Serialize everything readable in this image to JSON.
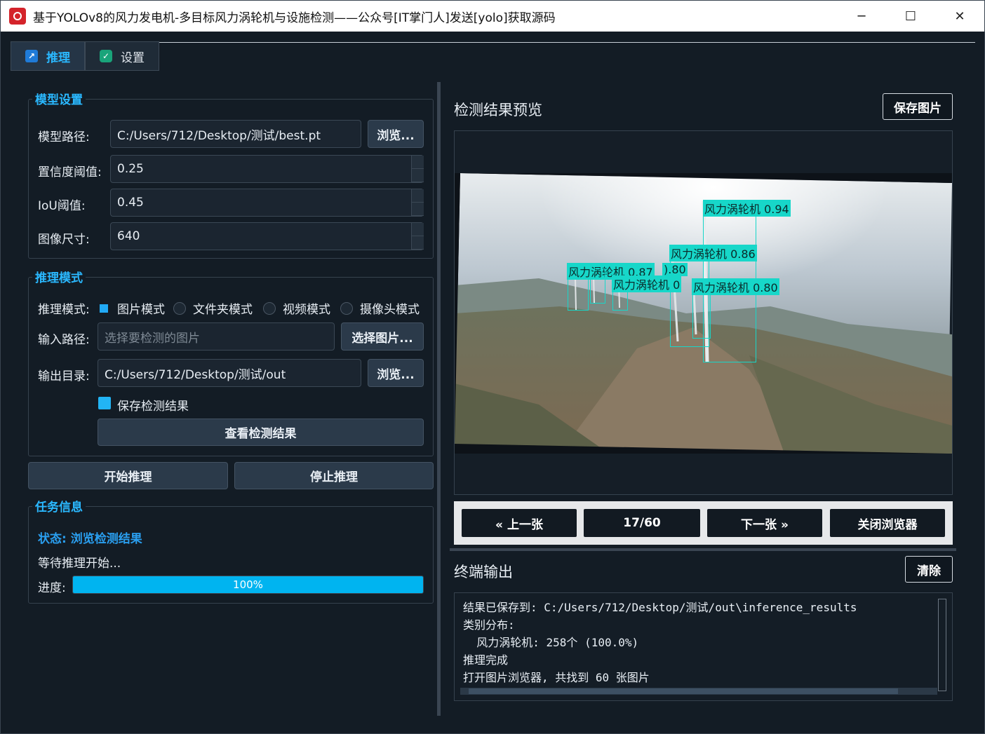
{
  "window": {
    "title": "基于YOLOv8的风力发电机-多目标风力涡轮机与设施检测——公众号[IT掌门人]发送[yolo]获取源码",
    "minimize": "─",
    "maximize": "☐",
    "close": "✕"
  },
  "tabs": [
    {
      "label": "推理",
      "icon": "chart-icon"
    },
    {
      "label": "设置",
      "icon": "check-icon"
    }
  ],
  "model_settings": {
    "title": "模型设置",
    "model_path_label": "模型路径:",
    "model_path_value": "C:/Users/712/Desktop/测试/best.pt",
    "browse_label": "浏览...",
    "conf_label": "置信度阈值:",
    "conf_value": "0.25",
    "iou_label": "IoU阈值:",
    "iou_value": "0.45",
    "imgsz_label": "图像尺寸:",
    "imgsz_value": "640"
  },
  "inference_mode": {
    "title": "推理模式",
    "mode_label": "推理模式:",
    "modes": [
      "图片模式",
      "文件夹模式",
      "视频模式",
      "摄像头模式"
    ],
    "selected_mode": "图片模式",
    "input_label": "输入路径:",
    "input_placeholder": "选择要检测的图片",
    "select_image_label": "选择图片...",
    "output_label": "输出目录:",
    "output_value": "C:/Users/712/Desktop/测试/out",
    "browse_label": "浏览...",
    "save_results_label": "保存检测结果",
    "save_results_checked": true,
    "view_results_label": "查看检测结果"
  },
  "actions": {
    "start_label": "开始推理",
    "stop_label": "停止推理"
  },
  "task_info": {
    "title": "任务信息",
    "status": "状态: 浏览检测结果",
    "message": "等待推理开始...",
    "progress_label": "进度:",
    "progress_value": 100,
    "progress_text": "100%"
  },
  "preview": {
    "title": "检测结果预览",
    "save_image_label": "保存图片",
    "detections": [
      {
        "label": "风力涡轮机 0.94"
      },
      {
        "label": "风力涡轮机 0.86"
      },
      {
        "label": "风力涡轮机 0.87"
      },
      {
        "label": ").80"
      },
      {
        "label": "风力涡轮机 0"
      },
      {
        "label": "风力涡轮机 0.80"
      }
    ],
    "nav": {
      "prev_label": "« 上一张",
      "counter": "17/60",
      "next_label": "下一张 »",
      "close_label": "关闭浏览器"
    }
  },
  "terminal": {
    "title": "终端输出",
    "clear_label": "清除",
    "lines": [
      "结果已保存到: C:/Users/712/Desktop/测试/out\\inference_results",
      "类别分布:",
      "  风力涡轮机: 258个 (100.0%)",
      "推理完成",
      "打开图片浏览器, 共找到 60 张图片"
    ]
  },
  "colors": {
    "accent": "#2ab8ff",
    "progress": "#00b4f0",
    "detection_box": "#17d7c9",
    "app_icon": "#d4232a"
  }
}
